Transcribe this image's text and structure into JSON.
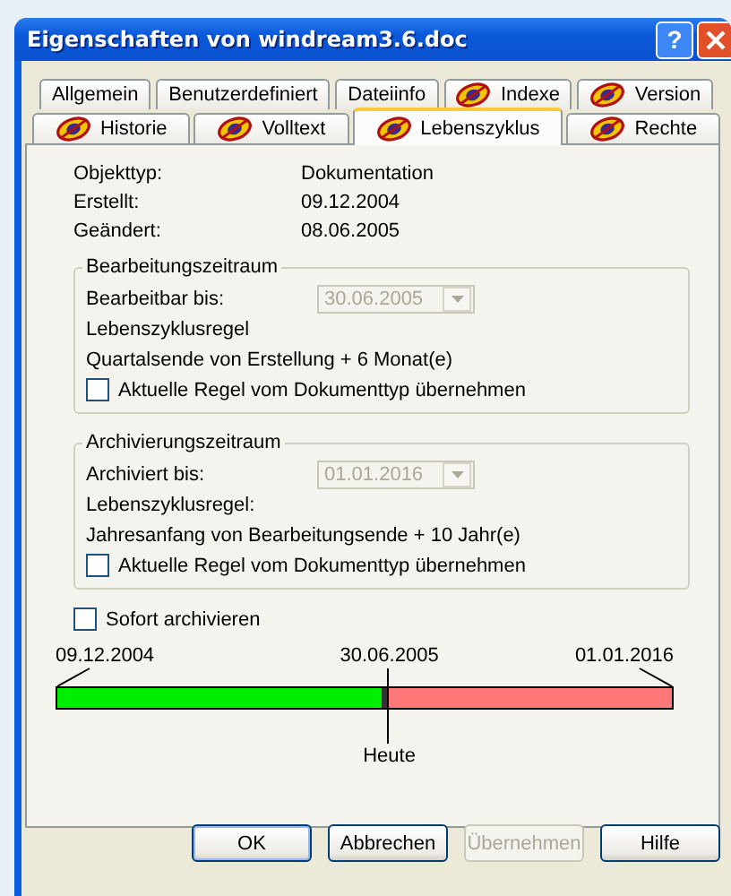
{
  "window": {
    "title": "Eigenschaften von windream3.6.doc",
    "help_button": "?"
  },
  "tab_rows": [
    {
      "tabs": [
        {
          "label": "Allgemein",
          "kind": "plain",
          "selected": false
        },
        {
          "label": "Benutzerdefiniert",
          "kind": "plain",
          "selected": false
        },
        {
          "label": "Dateiinfo",
          "kind": "plain",
          "selected": false
        },
        {
          "label": "Indexe",
          "kind": "icon",
          "selected": false
        },
        {
          "label": "Version",
          "kind": "icon",
          "selected": false
        }
      ]
    },
    {
      "tabs": [
        {
          "label": "Historie",
          "kind": "icon",
          "selected": false
        },
        {
          "label": "Volltext",
          "kind": "icon",
          "selected": false
        },
        {
          "label": "Lebenszyklus",
          "kind": "icon",
          "selected": true
        },
        {
          "label": "Rechte",
          "kind": "icon",
          "selected": false
        }
      ]
    }
  ],
  "info": [
    {
      "label": "Objekttyp:",
      "value": "Dokumentation"
    },
    {
      "label": "Erstellt:",
      "value": "09.12.2004"
    },
    {
      "label": "Geändert:",
      "value": "08.06.2005"
    }
  ],
  "groups": [
    {
      "title": "Bearbeitungszeitraum",
      "field_label": "Bearbeitbar bis:",
      "field_value": "30.06.2005",
      "field_disabled": true,
      "rule_label": "Lebenszyklusregel",
      "rule": "Quartalsende von Erstellung + 6 Monat(e)",
      "checkbox": {
        "label": "Aktuelle Regel vom Dokumenttyp übernehmen",
        "checked": false
      }
    },
    {
      "title": "Archivierungszeitraum",
      "field_label": "Archiviert bis:",
      "field_value": "01.01.2016",
      "field_disabled": true,
      "rule_label": "Lebenszyklusregel:",
      "rule": "Jahresanfang von Bearbeitungsende + 10 Jahr(e)",
      "checkbox": {
        "label": "Aktuelle Regel vom Dokumenttyp übernehmen",
        "checked": false
      }
    }
  ],
  "archive_now": {
    "label": "Sofort archivieren",
    "checked": false
  },
  "timeline": {
    "start": "09.12.2004",
    "mid": "30.06.2005",
    "end": "01.01.2016",
    "today": "Heute",
    "level": 0.54
  },
  "buttons": [
    {
      "label": "OK",
      "default": true,
      "disabled": false
    },
    {
      "label": "Abbrechen",
      "default": false,
      "disabled": false
    },
    {
      "label": "Übernehmen",
      "default": false,
      "disabled": true
    },
    {
      "label": "Hilfe",
      "default": false,
      "disabled": false
    }
  ]
}
